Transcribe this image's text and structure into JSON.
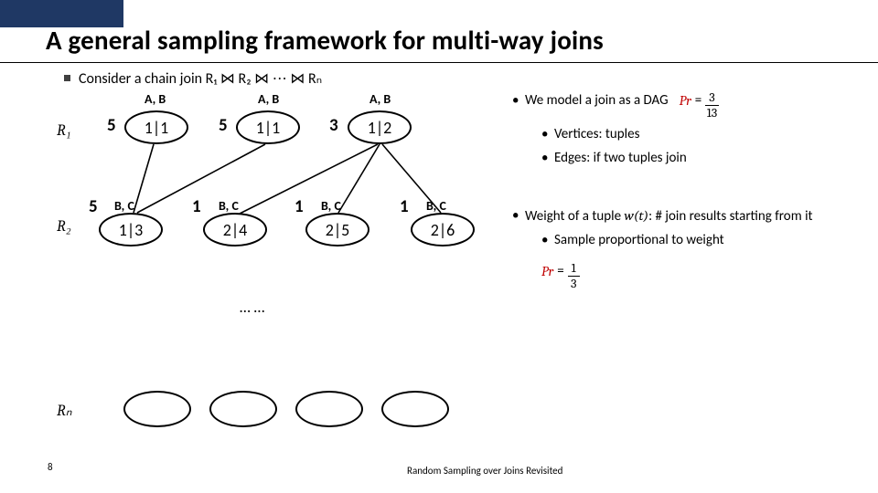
{
  "title": "A general sampling framework for multi-way joins",
  "consider_line": "Consider a chain join R₁ ⋈ R₂ ⋈ ⋯ ⋈ Rₙ",
  "relations": {
    "r1": "R₁",
    "r2": "R₂",
    "rn": "Rₙ"
  },
  "row1": [
    {
      "head": "A, B",
      "weight": "5",
      "val": "1|1"
    },
    {
      "head": "A, B",
      "weight": "5",
      "val": "1|1"
    },
    {
      "head": "A, B",
      "weight": "3",
      "val": "1|2"
    }
  ],
  "row2": [
    {
      "head": "B, C",
      "weight": "5",
      "val": "1|3"
    },
    {
      "head": "B, C",
      "weight": "1",
      "val": "2|4"
    },
    {
      "head": "B, C",
      "weight": "1",
      "val": "2|5"
    },
    {
      "head": "B, C",
      "weight": "1",
      "val": "2|6"
    }
  ],
  "row3_vdots": "… …",
  "bullets": {
    "dag": "We model a join as a DAG",
    "vertices": "Vertices: tuples",
    "edges": "Edges: if two tuples join",
    "weight_prefix": "Weight of a tuple ",
    "weight_fn": "w(t)",
    "weight_suffix": ": # join results starting from it",
    "sample": "Sample proportional to weight"
  },
  "pr1": {
    "label": "Pr",
    "eq": "=",
    "num": "3",
    "den": "13"
  },
  "pr2": {
    "label": "Pr",
    "eq": "=",
    "num": "1",
    "den": "3"
  },
  "footer": {
    "page": "8",
    "caption": "Random Sampling over Joins Revisited"
  }
}
